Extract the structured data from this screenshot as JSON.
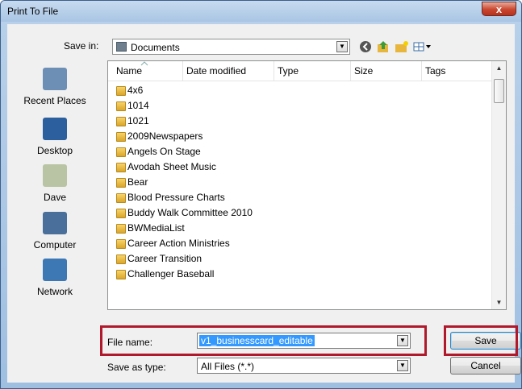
{
  "window": {
    "title": "Print To File",
    "close_glyph": "x"
  },
  "save_in": {
    "label": "Save in:",
    "value": "Documents"
  },
  "toolbar_icons": [
    "back-icon",
    "up-folder-icon",
    "new-folder-icon",
    "views-menu-icon"
  ],
  "places": [
    {
      "label": "Recent Places",
      "icon": "recent-places-icon",
      "color": "#6e8fb5"
    },
    {
      "label": "Desktop",
      "icon": "desktop-icon",
      "color": "#2c5f9e"
    },
    {
      "label": "Dave",
      "icon": "user-folder-icon",
      "color": "#b8c4a3"
    },
    {
      "label": "Computer",
      "icon": "computer-icon",
      "color": "#4a6f9a"
    },
    {
      "label": "Network",
      "icon": "network-icon",
      "color": "#3d78b5"
    }
  ],
  "columns": [
    "Name",
    "Date modified",
    "Type",
    "Size",
    "Tags"
  ],
  "files": [
    "4x6",
    "1014",
    "1021",
    "2009Newspapers",
    "Angels On Stage",
    "Avodah Sheet Music",
    "Bear",
    "Blood Pressure Charts",
    "Buddy Walk Committee 2010",
    "BWMediaList",
    "Career Action Ministries",
    "Career Transition",
    "Challenger Baseball"
  ],
  "file_name": {
    "label": "File name:",
    "value": "v1_businesscard_editable"
  },
  "save_as_type": {
    "label": "Save as type:",
    "value": "All Files (*.*)"
  },
  "buttons": {
    "save": "Save",
    "cancel": "Cancel"
  },
  "colors": {
    "highlight": "#b0192b",
    "selection": "#3399ff"
  }
}
